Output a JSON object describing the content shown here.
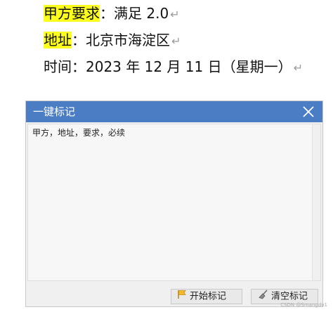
{
  "document": {
    "line1": {
      "label": "甲方要求",
      "colon": "：",
      "value": "满足 2.0"
    },
    "line2": {
      "label": "地址",
      "colon": "：",
      "value": "北京市海淀区"
    },
    "line3": {
      "text": "时间：2023 年 12 月 11 日（星期一）"
    },
    "paragraph_mark": "↵",
    "highlight_color": "#ffff1e"
  },
  "dialog": {
    "title": "一键标记",
    "close_icon": "close-icon",
    "textarea_value": "甲方，地址，要求，必续",
    "buttons": {
      "start_label": "开始标记",
      "start_icon": "flag-icon",
      "clear_label": "清空标记",
      "clear_icon": "broom-icon"
    },
    "title_bar_color": "#4b7dc4"
  },
  "watermark": "CSDN @Smangdo1"
}
